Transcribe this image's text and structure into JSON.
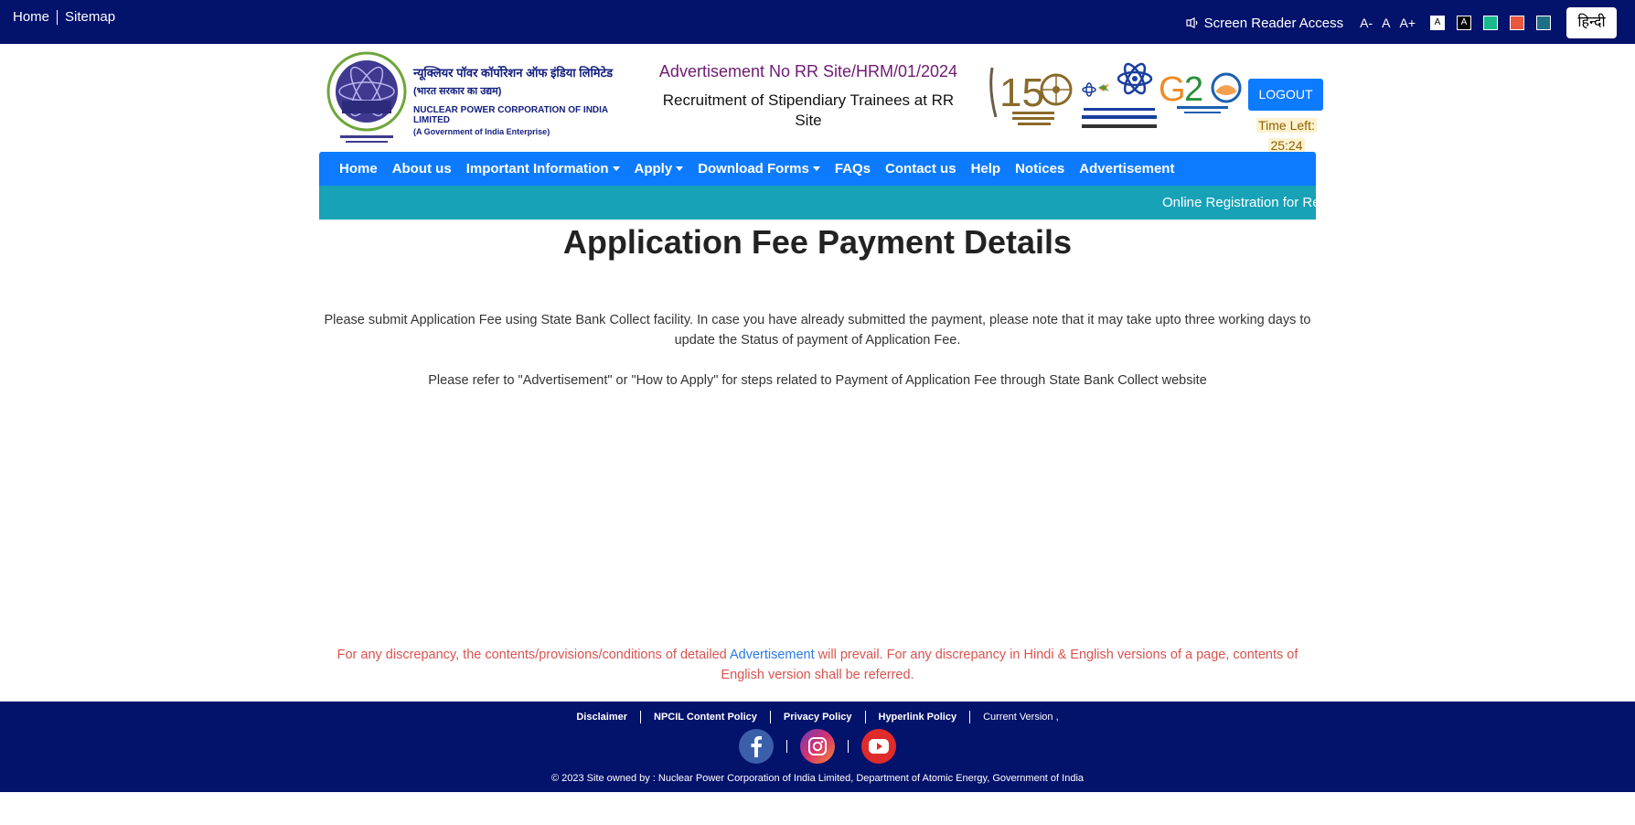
{
  "topbar": {
    "home": "Home",
    "sitemap": "Sitemap",
    "screen_reader": "Screen Reader Access",
    "font_decrease": "A-",
    "font_normal": "A",
    "font_increase": "A+",
    "theme_white_label": "A",
    "theme_black_label": "A",
    "language": "हिन्दी",
    "theme_colors": [
      "#ffffff",
      "#000000",
      "#19b98a",
      "#e9573f",
      "#1d6f86"
    ]
  },
  "header": {
    "logo_text": "NPCIL",
    "org_hindi_1": "न्यूक्लियर पॉवर कॉर्पोरेशन ऑफ इंडिया लिमिटेड",
    "org_hindi_2": "(भारत सरकार का उद्यम)",
    "org_english_1": "NUCLEAR POWER CORPORATION OF INDIA LIMITED",
    "org_english_2": "(A Government of India Enterprise)",
    "advertisement_no": "Advertisement No RR Site/HRM/01/2024",
    "recruitment_title": "Recruitment of Stipendiary Trainees at RR Site",
    "logout": "LOGOUT",
    "time_left_label": "Time Left:",
    "time_left_value": "25:24"
  },
  "nav": {
    "items": [
      {
        "label": "Home",
        "dropdown": false
      },
      {
        "label": "About us",
        "dropdown": false
      },
      {
        "label": "Important Information",
        "dropdown": true
      },
      {
        "label": "Apply",
        "dropdown": true
      },
      {
        "label": "Download Forms",
        "dropdown": true
      },
      {
        "label": "FAQs",
        "dropdown": false
      },
      {
        "label": "Contact us",
        "dropdown": false
      },
      {
        "label": "Help",
        "dropdown": false
      },
      {
        "label": "Notices",
        "dropdown": false
      },
      {
        "label": "Advertisement",
        "dropdown": false
      }
    ]
  },
  "ticker": {
    "text": "Online Registration for Re"
  },
  "main": {
    "title": "Application Fee Payment Details",
    "para1": "Please submit Application Fee using State Bank Collect facility. In case you have already submitted the payment, please note that it may take upto three working days to update the Status of payment of Application Fee.",
    "para2": "Please refer to \"Advertisement\" or \"How to Apply\" for steps related to Payment of Application Fee through State Bank Collect website",
    "disclaimer_pre": "For any discrepancy, the contents/provisions/conditions of detailed ",
    "disclaimer_link": "Advertisement",
    "disclaimer_post": " will prevail. For any discrepancy in Hindi & English versions of a page, contents of English version shall be referred."
  },
  "footer": {
    "links": [
      "Disclaimer",
      "NPCIL Content Policy",
      "Privacy Policy",
      "Hyperlink Policy"
    ],
    "version": "Current Version ,",
    "copyright": "© 2023 Site owned by : Nuclear Power Corporation of India Limited, Department of Atomic Energy, Government of India"
  }
}
